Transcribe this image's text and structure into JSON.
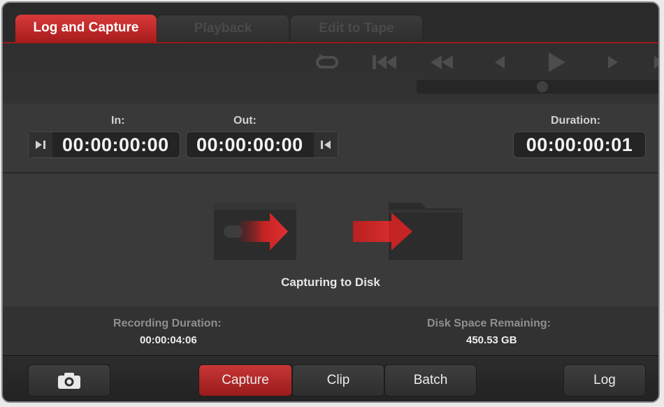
{
  "tabs": [
    {
      "label": "Log and Capture",
      "active": true
    },
    {
      "label": "Playback",
      "active": false
    },
    {
      "label": "Edit to Tape",
      "active": false
    }
  ],
  "transport": {
    "icons": [
      "loop-icon",
      "jump-to-start-icon",
      "rewind-icon",
      "step-back-icon",
      "play-icon",
      "step-forward-icon"
    ],
    "scrub_position": 0.5
  },
  "timecode": {
    "in_label": "In:",
    "in_value": "00:00:00:00",
    "out_label": "Out:",
    "out_value": "00:00:00:00",
    "duration_label": "Duration:",
    "duration_value": "00:00:00:01"
  },
  "status": {
    "text": "Capturing to Disk"
  },
  "info": {
    "recording_duration_label": "Recording Duration:",
    "recording_duration_value": "00:00:04:06",
    "disk_space_label": "Disk Space Remaining:",
    "disk_space_value": "450.53 GB"
  },
  "bottom": {
    "capture_label": "Capture",
    "clip_label": "Clip",
    "batch_label": "Batch",
    "log_label": "Log"
  },
  "colors": {
    "accent_red": "#c83030",
    "background": "#3a3a3a",
    "timecode_bg": "#242424"
  }
}
